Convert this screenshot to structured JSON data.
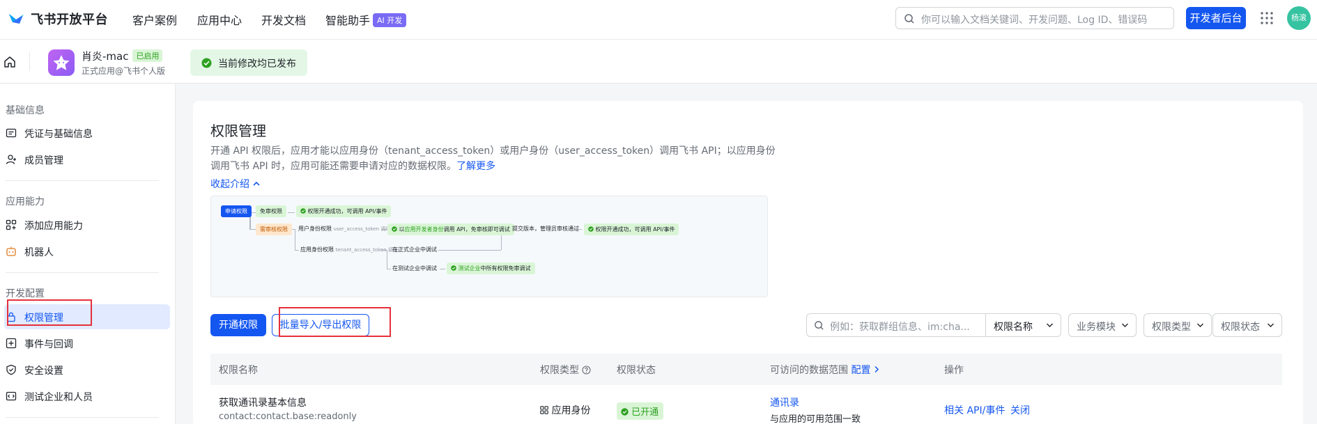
{
  "topnav": {
    "brand": "飞书开放平台",
    "links": [
      "客户案例",
      "应用中心",
      "开发文档",
      "智能助手"
    ],
    "ai_badge": "AI 开发",
    "search_placeholder": "你可以输入文档关键词、开发问题、Log ID、错误码",
    "dev_button": "开发者后台",
    "avatar_text": "杨滚"
  },
  "appbar": {
    "app_name": "肖炎-mac",
    "enabled_badge": "已启用",
    "app_sub": "正式应用@飞书个人版",
    "publish_status": "当前修改均已发布"
  },
  "sidebar": {
    "sections": [
      {
        "title": "基础信息",
        "items": [
          {
            "label": "凭证与基础信息",
            "icon": "credential-icon"
          },
          {
            "label": "成员管理",
            "icon": "member-icon"
          }
        ]
      },
      {
        "title": "应用能力",
        "items": [
          {
            "label": "添加应用能力",
            "icon": "add-capability-icon"
          },
          {
            "label": "机器人",
            "icon": "robot-icon"
          }
        ]
      },
      {
        "title": "开发配置",
        "items": [
          {
            "label": "权限管理",
            "icon": "lock-icon",
            "active": true
          },
          {
            "label": "事件与回调",
            "icon": "event-icon"
          },
          {
            "label": "安全设置",
            "icon": "shield-icon"
          },
          {
            "label": "测试企业和人员",
            "icon": "test-icon"
          }
        ]
      }
    ]
  },
  "main": {
    "title": "权限管理",
    "intro": "开通 API 权限后，应用才能以应用身份（tenant_access_token）或用户身份（user_access_token）调用飞书 API；以应用身份调用飞书 API 时，应用可能还需要申请对应的数据权限。",
    "learn_more": "了解更多",
    "collapse": "收起介绍",
    "diagram": {
      "apply": "申请权限",
      "no_review": "免审权限",
      "no_review_result": "权限开通成功，可调用 API/事件",
      "need_review": "需审核权限",
      "user_identity": "用户身份权限",
      "user_token": "user_access_token 调用",
      "dev_identity_a": "以",
      "dev_identity_hl": "应用开发者身份",
      "dev_identity_b": "调用 API，免审核即可调试",
      "submit": "提交版本，管理员审核通过",
      "final_result": "权限开通成功，可调用 API/事件",
      "app_identity": "应用身份权限",
      "tenant_token": "tenant_access_token 调用",
      "prod_debug": "在正式企业中调试",
      "test_debug": "在测试企业中调试",
      "test_result_hl": "测试企业",
      "test_result": "中所有权限免审调试"
    },
    "btn_enable": "开通权限",
    "btn_batch": "批量导入/导出权限",
    "filter_placeholder": "例如：获取群组信息、im:cha...",
    "filters": [
      "权限名称",
      "业务模块",
      "权限类型",
      "权限状态"
    ],
    "table": {
      "headers": {
        "name": "权限名称",
        "type": "权限类型",
        "status": "权限状态",
        "scope": "可访问的数据范围",
        "config": "配置",
        "ops": "操作"
      },
      "rows": [
        {
          "name": "获取通讯录基本信息",
          "code": "contact:contact.base:readonly",
          "type": "应用身份",
          "status": "已开通",
          "scope_link": "通讯录",
          "scope_desc": "与应用的可用范围一致",
          "op1": "相关 API/事件",
          "op2": "关闭"
        }
      ]
    }
  },
  "colors": {
    "accent": "#1456f0",
    "success": "#2ea121",
    "highlight_box": "#e5303a"
  }
}
